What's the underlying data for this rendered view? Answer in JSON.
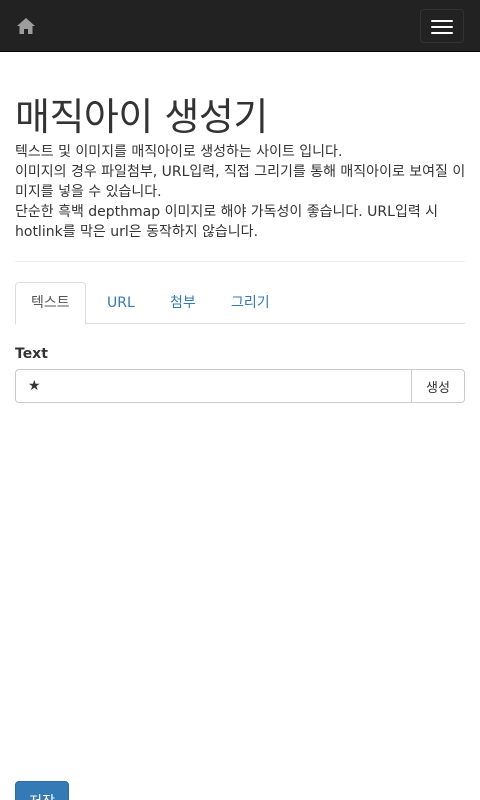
{
  "navbar": {
    "home_icon": "home-icon",
    "menu_icon": "hamburger-menu-icon"
  },
  "header": {
    "title": "매직아이 생성기",
    "description": [
      "텍스트 및 이미지를 매직아이로 생성하는 사이트 입니다.",
      "이미지의 경우 파일첨부, URL입력, 직접 그리기를 통해 매직아이로 보여질 이미지를 넣을 수 있습니다.",
      "단순한 흑백 depthmap 이미지로 해야 가독성이 좋습니다. URL입력 시 hotlink를 막은 url은 동작하지 않습니다."
    ]
  },
  "tabs": [
    {
      "label": "텍스트",
      "active": true
    },
    {
      "label": "URL",
      "active": false
    },
    {
      "label": "첨부",
      "active": false
    },
    {
      "label": "그리기",
      "active": false
    }
  ],
  "form": {
    "text_label": "Text",
    "text_value": "★",
    "generate_label": "생성"
  },
  "footer": {
    "save_label": "저장"
  },
  "colors": {
    "navbar_bg": "#222222",
    "link": "#337ab7",
    "primary": "#337ab7"
  }
}
